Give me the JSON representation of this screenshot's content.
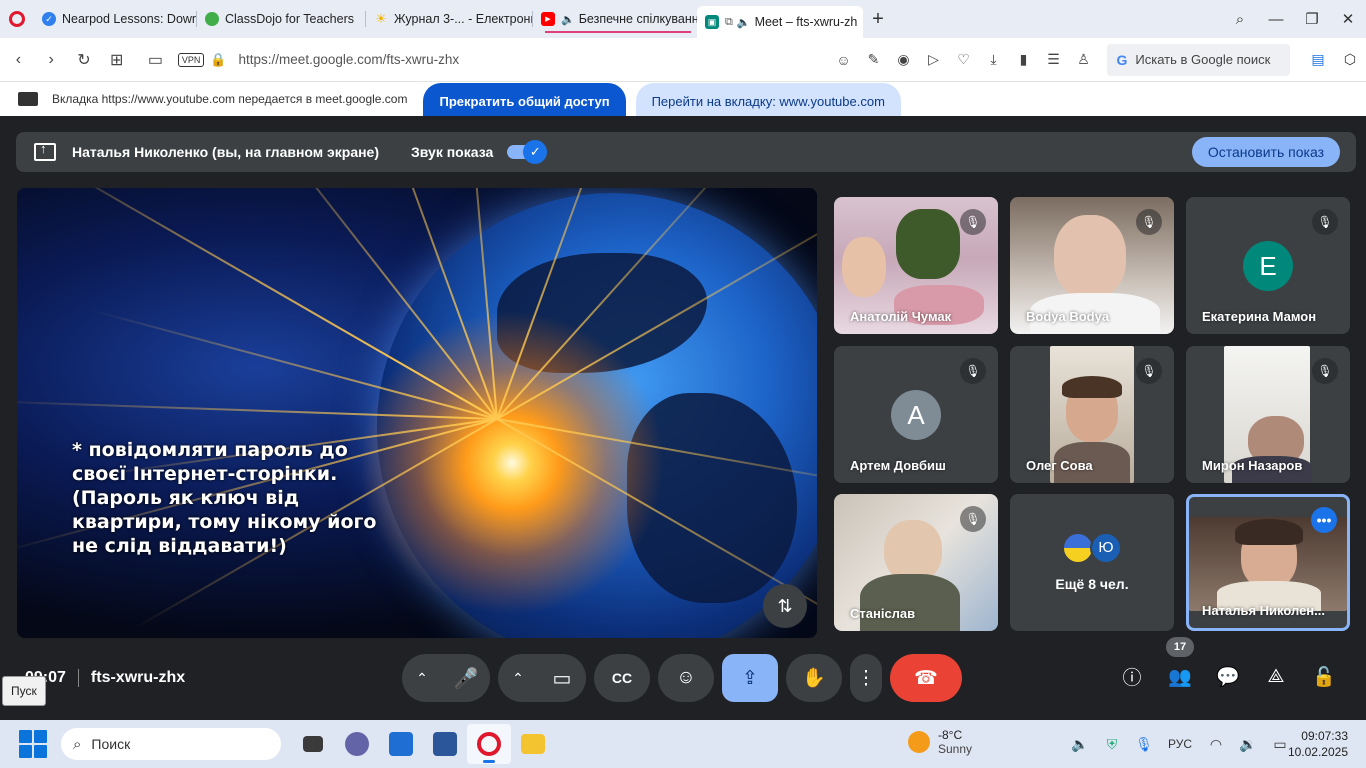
{
  "browser": {
    "tabs": [
      {
        "label": "Nearpod Lessons: Downlo",
        "fav_color": "#2f80ed",
        "round": true
      },
      {
        "label": "ClassDojo for Teachers",
        "fav_color": "#3fae49",
        "round": true
      },
      {
        "label": "Журнал 3-... - Електронні",
        "fav_color": "#f5b400",
        "round": false
      },
      {
        "label": "Безпечне спілкування",
        "fav_color": "#ff0000",
        "round": false
      },
      {
        "label": "Meet – fts-xwru-zh",
        "fav_color": "#00897b",
        "round": false
      }
    ],
    "new_tab": "+",
    "url": "https://meet.google.com/fts-xwru-zhx",
    "vpn": "VPN",
    "search_placeholder": "Искать в Google поиск",
    "search_g": "G"
  },
  "sharebar": {
    "text": "Вкладка https://www.youtube.com передается в meet.google.com",
    "stop_label": "Прекратить общий доступ",
    "goto_label": "Перейти на вкладку: www.youtube.com"
  },
  "presenting": {
    "name": "Наталья Николенко (вы, на главном экране)",
    "sound_label": "Звук показа",
    "stop_label": "Остановить показ"
  },
  "screen": {
    "caption": "* повідомляти пароль до своєї Інтернет-сторінки. (Пароль як ключ від квартири, тому нікому його не слід віддавати!)"
  },
  "participants": [
    {
      "name": "Анатолій Чумак",
      "type": "video"
    },
    {
      "name": "Bodya Bodya",
      "type": "video"
    },
    {
      "name": "Екатерина Мамон",
      "type": "avatar",
      "initial": "E",
      "color": "#00897b"
    },
    {
      "name": "Артем Довбиш",
      "type": "avatar",
      "initial": "A",
      "color": "#7f8c95"
    },
    {
      "name": "Олег Сова",
      "type": "video"
    },
    {
      "name": "Мирон Назаров",
      "type": "video"
    },
    {
      "name": "Станіслав",
      "type": "video"
    },
    {
      "name": "Наталья Николен...",
      "type": "video"
    }
  ],
  "more": {
    "label": "Ещё 8 чел.",
    "avatar_initial": "Ю"
  },
  "meeting": {
    "time": "09:07",
    "code": "fts-xwru-zhx",
    "participants_count": "17"
  },
  "tooltip": "Пуск",
  "taskbar": {
    "search": "Поиск",
    "temp": "-8°C",
    "weather": "Sunny",
    "lang": "РУС",
    "time": "09:07:33",
    "date": "10.02.2025"
  }
}
